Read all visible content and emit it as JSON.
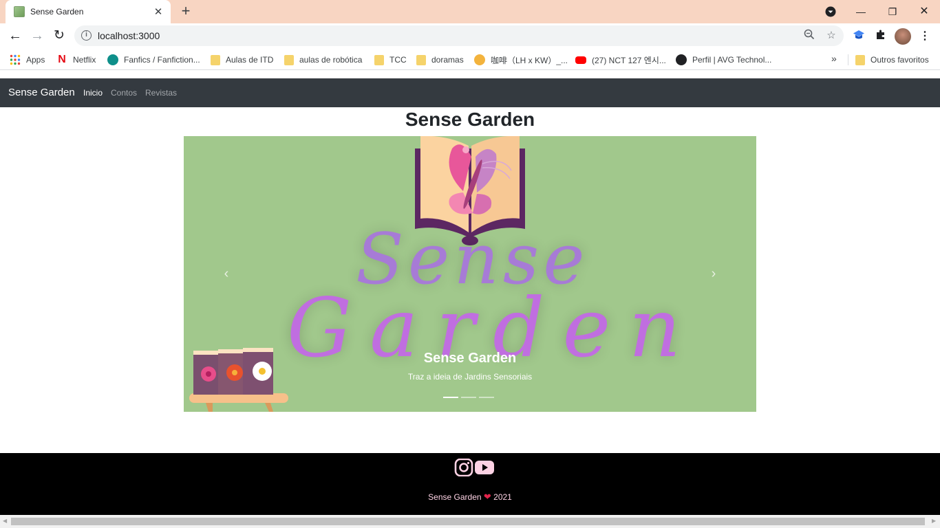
{
  "browser": {
    "tab_title": "Sense Garden",
    "url": "localhost:3000",
    "bookmarks": [
      {
        "label": "Apps",
        "icon": "apps-grid-icon"
      },
      {
        "label": "Netflix",
        "icon": "netflix-icon"
      },
      {
        "label": "Fanfics / Fanfiction...",
        "icon": "drop-icon"
      },
      {
        "label": "Aulas de ITD",
        "icon": "folder-icon"
      },
      {
        "label": "aulas de robótica",
        "icon": "folder-icon"
      },
      {
        "label": "TCC",
        "icon": "folder-icon"
      },
      {
        "label": "doramas",
        "icon": "folder-icon"
      },
      {
        "label": "咖啡（LH x KW）_...",
        "icon": "bee-icon"
      },
      {
        "label": "(27) NCT 127 엔시...",
        "icon": "youtube-icon"
      },
      {
        "label": "Perfil | AVG Technol...",
        "icon": "globe-icon"
      }
    ],
    "more_bookmarks": "»",
    "other_favorites": "Outros favoritos"
  },
  "site": {
    "brand": "Sense Garden",
    "nav": [
      {
        "label": "Inicio",
        "active": true
      },
      {
        "label": "Contos",
        "active": false
      },
      {
        "label": "Revistas",
        "active": false
      }
    ],
    "page_title": "Sense Garden",
    "carousel": {
      "logo_line1": "Sense",
      "logo_line2": "Garden",
      "caption_title": "Sense Garden",
      "caption_text": "Traz a ideia de Jardins Sensoriais",
      "slide_count": 3,
      "active_slide": 1
    },
    "footer": {
      "social": [
        "instagram-icon",
        "youtube-icon"
      ],
      "text_left": "Sense Garden",
      "text_right": "2021"
    }
  },
  "colors": {
    "tabbar": "#f8d5c2",
    "navbar": "#343a40",
    "carousel_bg": "#a1c88c",
    "logo_purple": "#b984db",
    "footer_pink": "#fdd2e4"
  }
}
